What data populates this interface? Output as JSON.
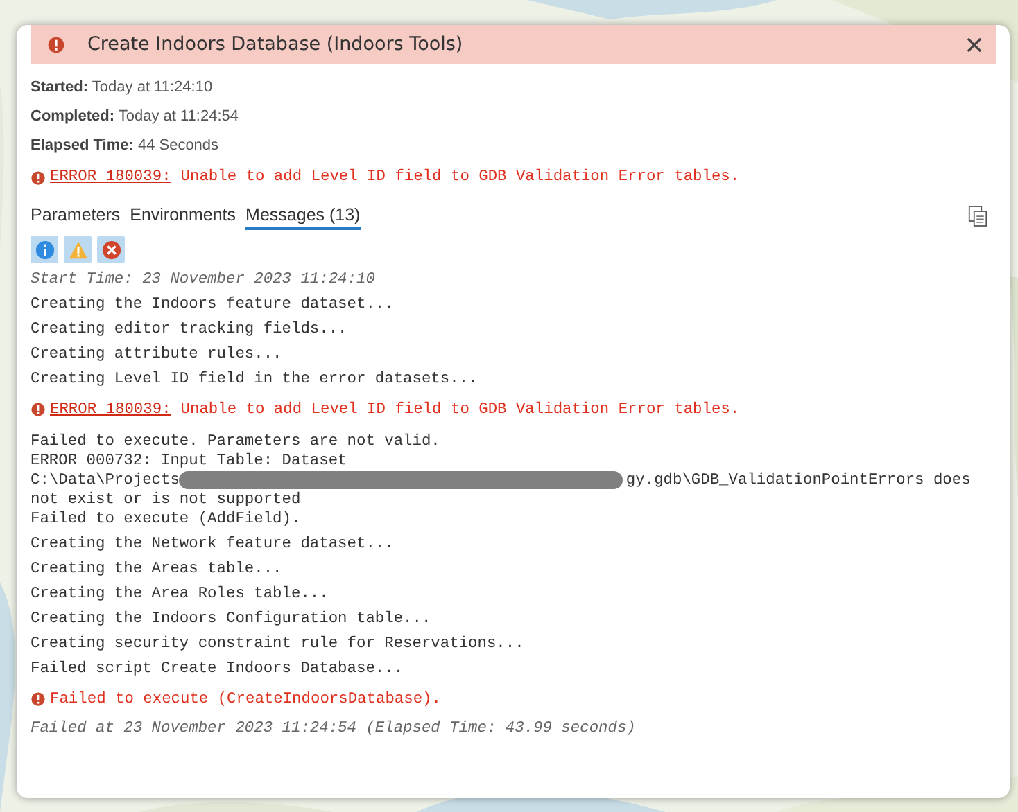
{
  "dialog": {
    "title": "Create Indoors Database (Indoors Tools)",
    "summary": [
      {
        "label": "Started:",
        "value": "Today at 11:24:10"
      },
      {
        "label": "Completed:",
        "value": "Today at 11:24:54"
      },
      {
        "label": "Elapsed Time:",
        "value": "44 Seconds"
      }
    ],
    "headline_error": {
      "code": "ERROR 180039:",
      "text": "Unable to add Level ID field to GDB Validation Error tables."
    },
    "tabs": [
      {
        "label": "Parameters",
        "selected": false
      },
      {
        "label": "Environments",
        "selected": false
      },
      {
        "label": "Messages (13)",
        "selected": true
      }
    ],
    "filters": [
      {
        "kind": "info",
        "selected": true
      },
      {
        "kind": "warning",
        "selected": true
      },
      {
        "kind": "error",
        "selected": true
      }
    ],
    "messages": [
      {
        "kind": "note",
        "text": "Start Time: 23 November 2023 11:24:10"
      },
      {
        "kind": "info",
        "text": "Creating the Indoors feature dataset..."
      },
      {
        "kind": "info",
        "text": "Creating editor tracking fields..."
      },
      {
        "kind": "info",
        "text": "Creating attribute rules..."
      },
      {
        "kind": "info",
        "text": "Creating Level ID field in the error datasets..."
      },
      {
        "kind": "error",
        "code": "ERROR 180039:",
        "text": "Unable to add Level ID field to GDB Validation Error tables."
      },
      {
        "kind": "block",
        "lines": [
          {
            "text": "Failed to execute. Parameters are not valid."
          },
          {
            "text": "ERROR 000732: Input Table: Dataset"
          },
          {
            "text": "C:\\Data\\Projects",
            "redacted": true,
            "text_after": "gy.gdb\\GDB_ValidationPointErrors does"
          },
          {
            "text": "not exist or is not supported"
          },
          {
            "text": "Failed to execute (AddField)."
          }
        ]
      },
      {
        "kind": "info",
        "text": "Creating the Network feature dataset..."
      },
      {
        "kind": "info",
        "text": "Creating the Areas table..."
      },
      {
        "kind": "info",
        "text": "Creating the Area Roles table..."
      },
      {
        "kind": "info",
        "text": "Creating the Indoors Configuration table..."
      },
      {
        "kind": "info",
        "text": "Creating security constraint rule for Reservations..."
      },
      {
        "kind": "info",
        "text": "Failed script Create Indoors Database..."
      },
      {
        "kind": "error",
        "text": "Failed to execute (CreateIndoorsDatabase)."
      },
      {
        "kind": "note",
        "text": "Failed at 23 November 2023 11:24:54 (Elapsed Time: 43.99 seconds)"
      }
    ]
  }
}
